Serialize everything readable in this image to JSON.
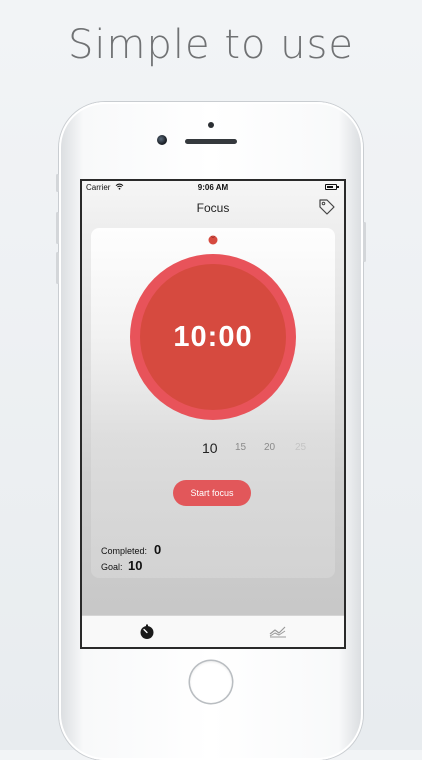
{
  "headline": "Simple to use",
  "status_bar": {
    "carrier": "Carrier",
    "time": "9:06 AM"
  },
  "nav": {
    "title": "Focus"
  },
  "timer": {
    "display": "10:00"
  },
  "duration_picker": {
    "options": [
      "10",
      "15",
      "20",
      "25"
    ],
    "selected": "10"
  },
  "actions": {
    "start_label": "Start focus"
  },
  "stats": {
    "completed_label": "Completed:",
    "completed_value": "0",
    "goal_label": "Goal:",
    "goal_value": "10"
  },
  "colors": {
    "accent": "#e2575a",
    "timer_face": "#d64a3f",
    "timer_ring": "#e8535a"
  },
  "icons": {
    "tag": "tag-icon",
    "tomato": "tomato-icon",
    "tab_timer": "stopwatch-icon",
    "tab_stats": "trend-chart-icon"
  }
}
